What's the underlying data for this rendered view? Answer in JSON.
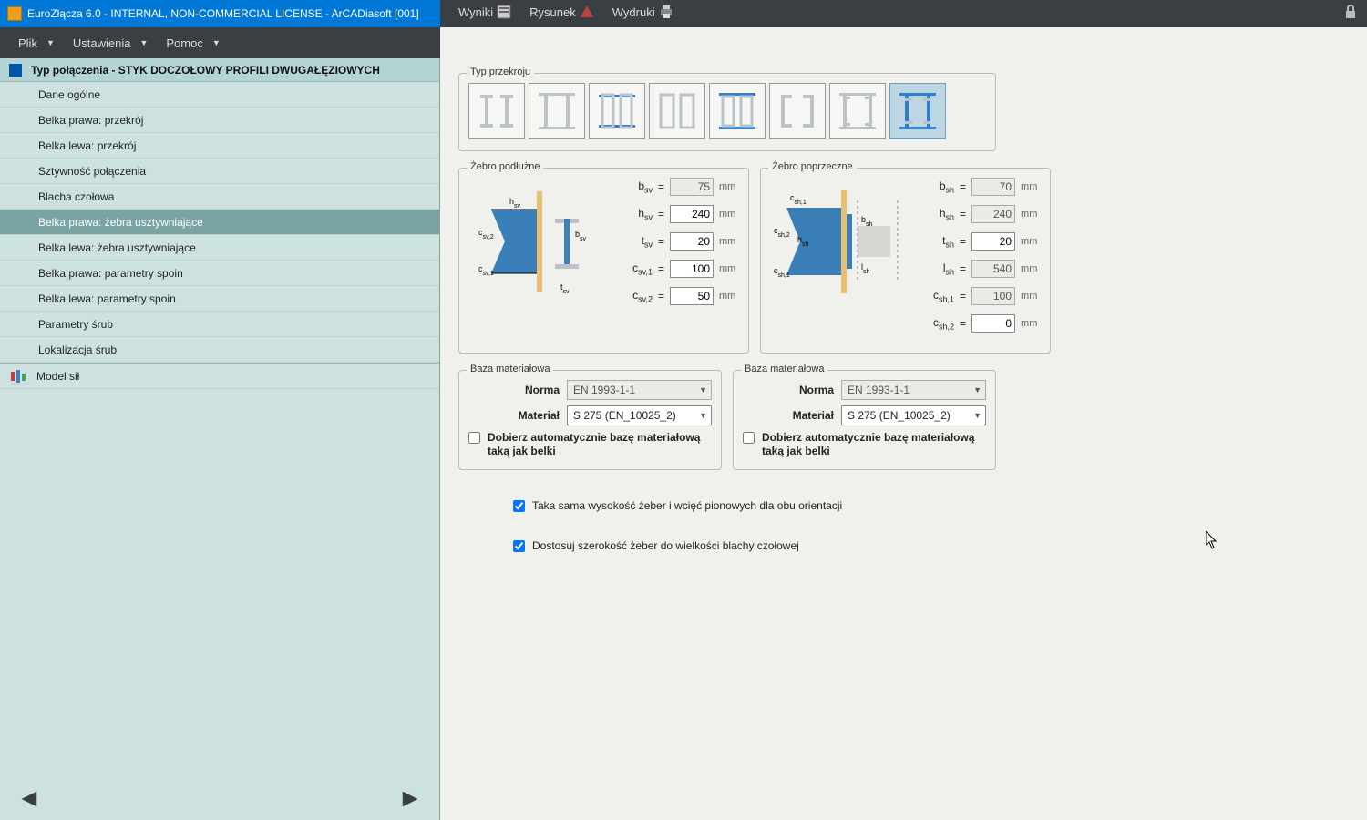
{
  "titlebar": {
    "title": "EuroZłącza 6.0 - INTERNAL, NON-COMMERCIAL LICENSE - ArCADiasoft [001]"
  },
  "menu_left": {
    "file": "Plik",
    "settings": "Ustawienia",
    "help": "Pomoc"
  },
  "menu_right": {
    "results": "Wyniki",
    "drawing": "Rysunek",
    "prints": "Wydruki"
  },
  "tree": {
    "header": "Typ połączenia - STYK DOCZOŁOWY PROFILI DWUGAŁĘZIOWYCH",
    "items": [
      "Dane ogólne",
      "Belka prawa: przekrój",
      "Belka lewa: przekrój",
      "Sztywność połączenia",
      "Blacha czołowa",
      "Belka prawa: żebra usztywniające",
      "Belka lewa: żebra usztywniające",
      "Belka prawa: parametry spoin",
      "Belka lewa: parametry spoin",
      "Parametry śrub",
      "Lokalizacja śrub"
    ],
    "selected": 5,
    "model": "Model sił"
  },
  "section": {
    "group_label": "Typ przekroju",
    "selected": 7
  },
  "rib_vert": {
    "legend": "Żebro podłużne",
    "b": {
      "label": "b<sub>sv</sub>",
      "eq": "=",
      "value": "75",
      "unit": "mm",
      "readonly": true
    },
    "h": {
      "label": "h<sub>sv</sub>",
      "eq": "=",
      "value": "240",
      "unit": "mm",
      "readonly": false
    },
    "t": {
      "label": "t<sub>sv</sub>",
      "eq": "=",
      "value": "20",
      "unit": "mm",
      "readonly": false
    },
    "c1": {
      "label": "c<sub>sv,1</sub>",
      "eq": "=",
      "value": "100",
      "unit": "mm",
      "readonly": false
    },
    "c2": {
      "label": "c<sub>sv,2</sub>",
      "eq": "=",
      "value": "50",
      "unit": "mm",
      "readonly": false
    }
  },
  "rib_horiz": {
    "legend": "Żebro poprzeczne",
    "b": {
      "label": "b<sub>sh</sub>",
      "eq": "=",
      "value": "70",
      "unit": "mm",
      "readonly": true
    },
    "h": {
      "label": "h<sub>sh</sub>",
      "eq": "=",
      "value": "240",
      "unit": "mm",
      "readonly": true
    },
    "t": {
      "label": "t<sub>sh</sub>",
      "eq": "=",
      "value": "20",
      "unit": "mm",
      "readonly": false
    },
    "l": {
      "label": "l<sub>sh</sub>",
      "eq": "=",
      "value": "540",
      "unit": "mm",
      "readonly": true
    },
    "c1": {
      "label": "c<sub>sh,1</sub>",
      "eq": "=",
      "value": "100",
      "unit": "mm",
      "readonly": true
    },
    "c2": {
      "label": "c<sub>sh,2</sub>",
      "eq": "=",
      "value": "0",
      "unit": "mm",
      "readonly": false
    }
  },
  "mat_left": {
    "legend": "Baza materiałowa",
    "norma_label": "Norma",
    "norma_value": "EN 1993-1-1",
    "material_label": "Materiał",
    "material_value": "S 275 (EN_10025_2)",
    "auto_label": "Dobierz automatycznie bazę materiałową taką jak belki"
  },
  "mat_right": {
    "legend": "Baza materiałowa",
    "norma_label": "Norma",
    "norma_value": "EN 1993-1-1",
    "material_label": "Materiał",
    "material_value": "S 275 (EN_10025_2)",
    "auto_label": "Dobierz automatycznie bazę materiałową taką jak belki"
  },
  "checks": {
    "same_height": "Taka sama wysokość żeber i wcięć pionowych dla obu orientacji",
    "adjust_width": "Dostosuj szerokość żeber do wielkości blachy czołowej"
  }
}
